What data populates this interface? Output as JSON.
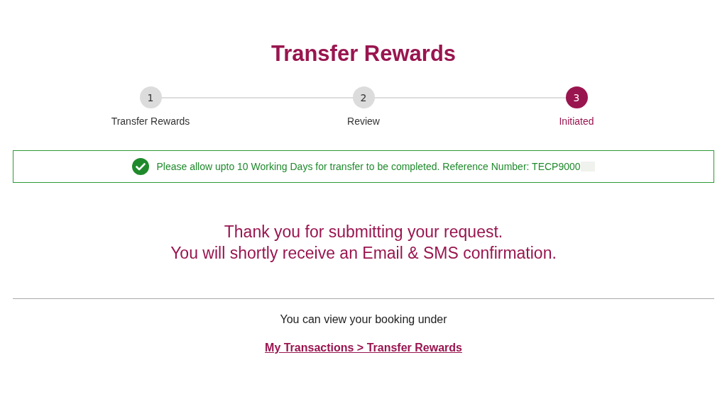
{
  "title": "Transfer Rewards",
  "steps": [
    {
      "number": "1",
      "label": "Transfer Rewards",
      "selected": false
    },
    {
      "number": "2",
      "label": "Review",
      "selected": false
    },
    {
      "number": "3",
      "label": "Initiated",
      "selected": true
    }
  ],
  "notice": {
    "text": "Please allow upto 10 Working Days for transfer to be completed. Reference Number: TECP9000",
    "redacted": true
  },
  "thanks": [
    "Thank you for submitting your request.",
    "You will shortly receive an Email & SMS confirmation."
  ],
  "footer": {
    "text": "You can view your booking under",
    "link": "My Transactions > Transfer Rewards"
  }
}
